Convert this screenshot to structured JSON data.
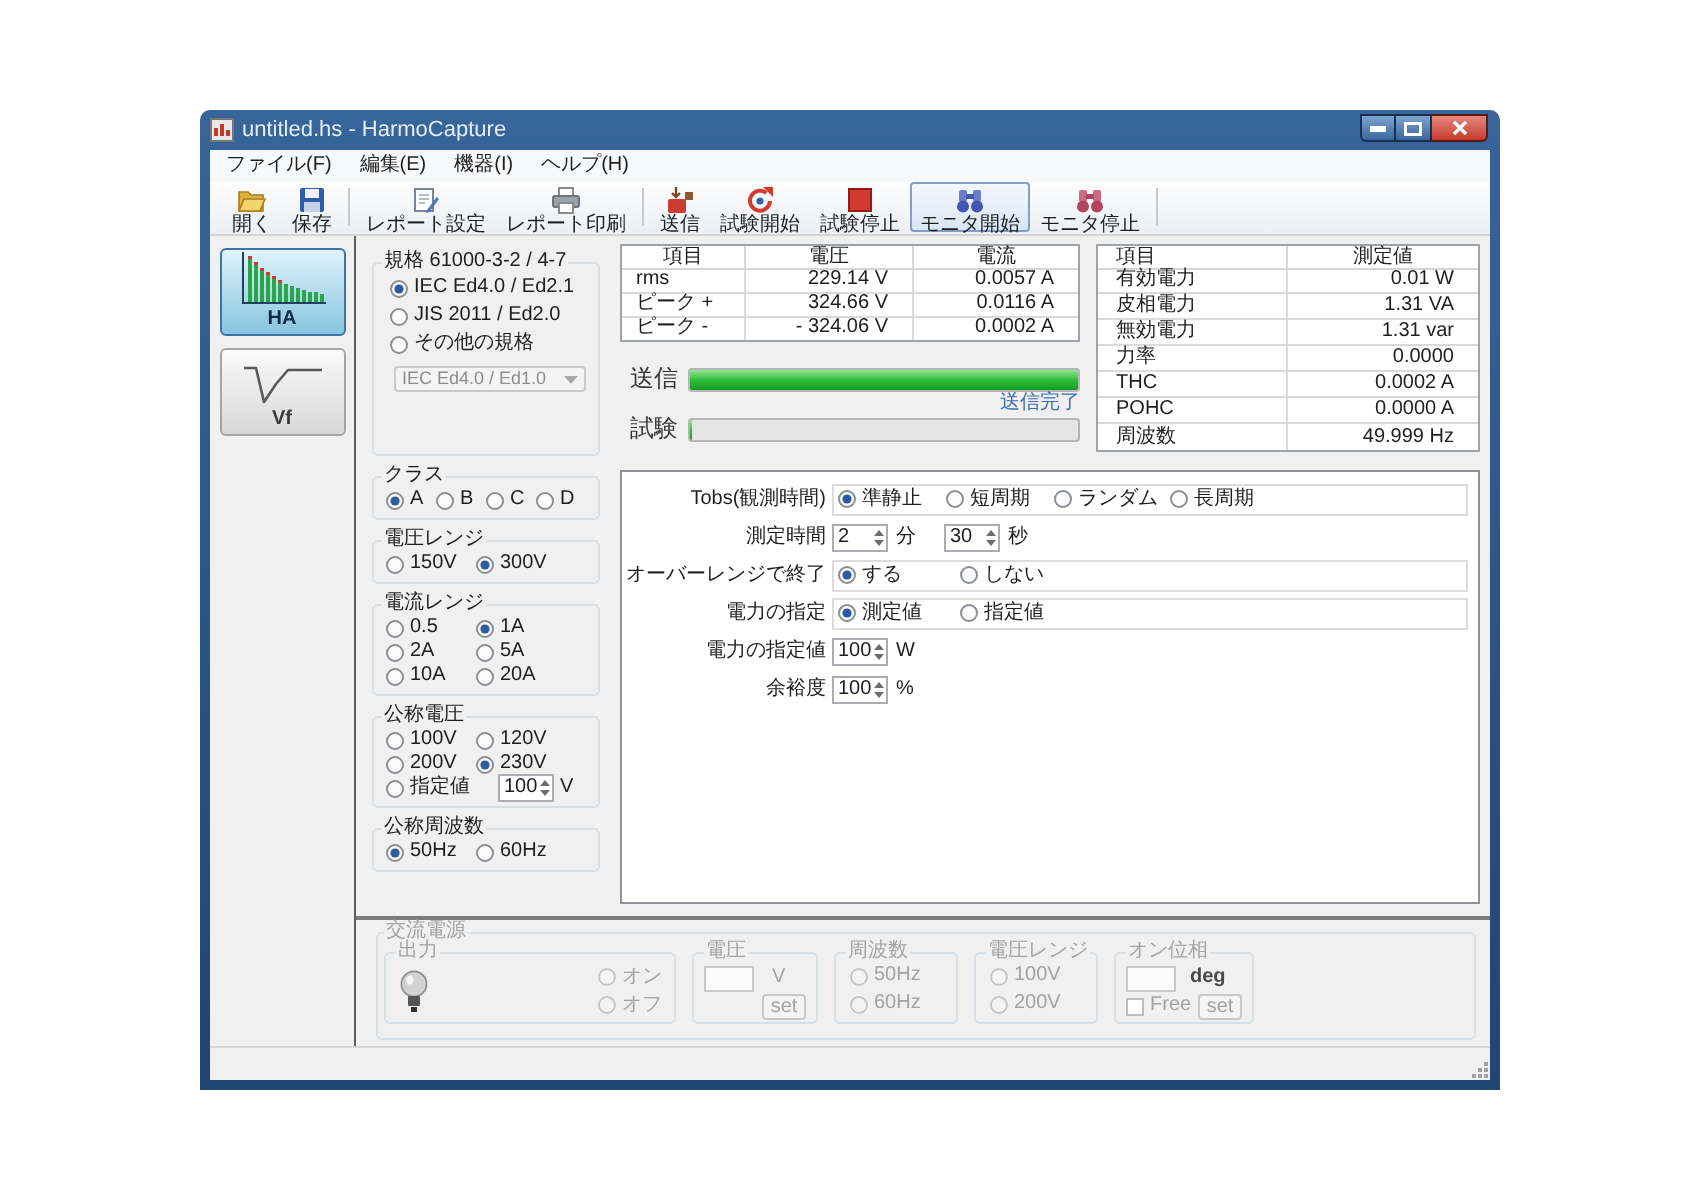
{
  "window": {
    "title": "untitled.hs - HarmoCapture"
  },
  "menu": [
    "ファイル(F)",
    "編集(E)",
    "機器(I)",
    "ヘルプ(H)"
  ],
  "toolbar": [
    {
      "buttons": [
        {
          "label": "開く",
          "pressed": false
        },
        {
          "label": "保存",
          "pressed": false
        }
      ]
    },
    {
      "buttons": [
        {
          "label": "レポート設定",
          "pressed": false
        },
        {
          "label": "レポート印刷",
          "pressed": false
        }
      ]
    },
    {
      "buttons": [
        {
          "label": "送信",
          "pressed": false
        },
        {
          "label": "試験開始",
          "pressed": false
        },
        {
          "label": "試験停止",
          "pressed": false
        },
        {
          "label": "モニタ開始",
          "pressed": true
        },
        {
          "label": "モニタ停止",
          "pressed": false
        }
      ]
    }
  ],
  "modes": [
    {
      "label": "HA",
      "selected": true
    },
    {
      "label": "Vf",
      "selected": false
    }
  ],
  "standard": {
    "title": "規格 61000-3-2 / 4-7",
    "options": [
      {
        "label": "IEC Ed4.0 / Ed2.1",
        "selected": true
      },
      {
        "label": "JIS 2011 / Ed2.0",
        "selected": false
      },
      {
        "label": "その他の規格",
        "selected": false
      }
    ],
    "dropdown": {
      "value": "IEC Ed4.0 / Ed1.0",
      "disabled": true
    }
  },
  "settings": [
    {
      "title": "クラス",
      "rows": [
        [
          {
            "label": "A",
            "selected": true
          },
          {
            "label": "B",
            "selected": false
          },
          {
            "label": "C",
            "selected": false
          },
          {
            "label": "D",
            "selected": false
          }
        ]
      ]
    },
    {
      "title": "電圧レンジ",
      "rows": [
        [
          {
            "label": "150V",
            "selected": false
          },
          {
            "label": "300V",
            "selected": true
          }
        ]
      ]
    },
    {
      "title": "電流レンジ",
      "rows": [
        [
          {
            "label": "0.5",
            "selected": false
          },
          {
            "label": "1A",
            "selected": true
          }
        ],
        [
          {
            "label": "2A",
            "selected": false
          },
          {
            "label": "5A",
            "selected": false
          }
        ],
        [
          {
            "label": "10A",
            "selected": false
          },
          {
            "label": "20A",
            "selected": false
          }
        ]
      ]
    },
    {
      "title": "公称電圧",
      "rows": [
        [
          {
            "label": "100V",
            "selected": false
          },
          {
            "label": "120V",
            "selected": false
          }
        ],
        [
          {
            "label": "200V",
            "selected": false
          },
          {
            "label": "230V",
            "selected": true
          }
        ],
        [
          {
            "label": "指定値",
            "selected": false,
            "spinner": {
              "value": "100",
              "unit": "V"
            }
          }
        ]
      ]
    },
    {
      "title": "公称周波数",
      "rows": [
        [
          {
            "label": "50Hz",
            "selected": true
          },
          {
            "label": "60Hz",
            "selected": false
          }
        ]
      ]
    }
  ],
  "readings": {
    "columns": [
      "項目",
      "電圧",
      "電流"
    ],
    "rows": [
      [
        "rms",
        "229.14 V",
        "0.0057 A"
      ],
      [
        "ピーク +",
        "324.66 V",
        "0.0116 A"
      ],
      [
        "ピーク -",
        "- 324.06 V",
        "0.0002 A"
      ]
    ]
  },
  "progress": [
    {
      "label": "送信",
      "level": 1,
      "status": "送信完了"
    },
    {
      "label": "試験",
      "level": 0
    }
  ],
  "power": {
    "columns": [
      "項目",
      "測定値"
    ],
    "rows": [
      [
        "有効電力",
        "0.01 W"
      ],
      [
        "皮相電力",
        "1.31 VA"
      ],
      [
        "無効電力",
        "1.31 var"
      ],
      [
        "力率",
        "0.0000"
      ],
      [
        "THC",
        "0.0002 A"
      ],
      [
        "POHC",
        "0.0000 A"
      ],
      [
        "周波数",
        "49.999 Hz"
      ]
    ]
  },
  "form": [
    {
      "kind": "radios",
      "label": "Tobs(観測時間)",
      "options": [
        {
          "label": "準静止",
          "selected": true
        },
        {
          "label": "短周期",
          "selected": false
        },
        {
          "label": "ランダム",
          "selected": false
        },
        {
          "label": "長周期",
          "selected": false
        }
      ]
    },
    {
      "kind": "spinners",
      "label": "測定時間",
      "fields": [
        {
          "value": "2",
          "unit": "分"
        },
        {
          "value": "30",
          "unit": "秒"
        }
      ]
    },
    {
      "kind": "radios",
      "label": "オーバーレンジで終了",
      "options": [
        {
          "label": "する",
          "selected": true
        },
        {
          "label": "しない",
          "selected": false
        }
      ]
    },
    {
      "kind": "radios",
      "label": "電力の指定",
      "options": [
        {
          "label": "測定値",
          "selected": true
        },
        {
          "label": "指定値",
          "selected": false
        }
      ]
    },
    {
      "kind": "spinners",
      "label": "電力の指定値",
      "fields": [
        {
          "value": "100",
          "unit": "W"
        }
      ]
    },
    {
      "kind": "spinners",
      "label": "余裕度",
      "fields": [
        {
          "value": "100",
          "unit": "%"
        }
      ]
    }
  ],
  "ac_power": {
    "title": "交流電源",
    "disabled": true,
    "groups": [
      {
        "kind": "output",
        "title": "出力",
        "options": [
          {
            "label": "オン",
            "selected": false
          },
          {
            "label": "オフ",
            "selected": false
          }
        ]
      },
      {
        "kind": "field",
        "title": "電圧",
        "unit": "V",
        "button": "set"
      },
      {
        "kind": "radios",
        "title": "周波数",
        "options": [
          {
            "label": "50Hz",
            "selected": false
          },
          {
            "label": "60Hz",
            "selected": false
          }
        ]
      },
      {
        "kind": "radios",
        "title": "電圧レンジ",
        "options": [
          {
            "label": "100V",
            "selected": false
          },
          {
            "label": "200V",
            "selected": false
          }
        ]
      },
      {
        "kind": "phase",
        "title": "オン位相",
        "unit": "deg",
        "checkbox": {
          "label": "Free",
          "checked": false
        },
        "button": "set"
      }
    ]
  }
}
